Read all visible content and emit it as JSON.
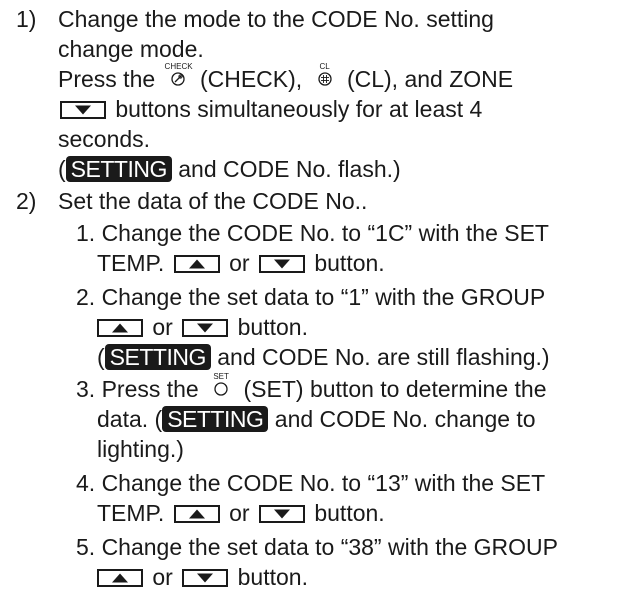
{
  "step1": {
    "num": "1)",
    "line1": "Change the mode to the CODE No. setting",
    "line2": "change mode.",
    "line3a": "Press the",
    "check_cap": "CHECK",
    "line3b": "(CHECK),",
    "cl_cap": "CL",
    "line3c": "(CL), and ZONE",
    "line4": "buttons simultaneously for at least 4",
    "line5": "seconds.",
    "line6a": "(",
    "setting_badge": "SETTING",
    "line6b": "and CODE No. flash.)"
  },
  "step2": {
    "num": "2)",
    "line1": "Set the data of the CODE No..",
    "sub1": {
      "a": "1. Change the CODE No. to “1C” with the SET",
      "b1": "TEMP.",
      "or": "or",
      "b2": "button."
    },
    "sub2": {
      "a": "2. Change the set data to “1” with the GROUP",
      "or": "or",
      "b2": "button.",
      "c1": "(",
      "c2": "and CODE No. are still flashing.)"
    },
    "sub3": {
      "a1": "3. Press the",
      "set_cap": "SET",
      "a2": "(SET) button to determine the",
      "b1": "data. (",
      "b2": "and CODE No. change to",
      "c": "lighting.)"
    },
    "sub4": {
      "a": "4. Change the CODE No. to “13” with the SET",
      "b1": "TEMP.",
      "or": "or",
      "b2": "button."
    },
    "sub5": {
      "a": "5. Change the set data to “38” with the GROUP",
      "or": "or",
      "b2": "button."
    }
  }
}
